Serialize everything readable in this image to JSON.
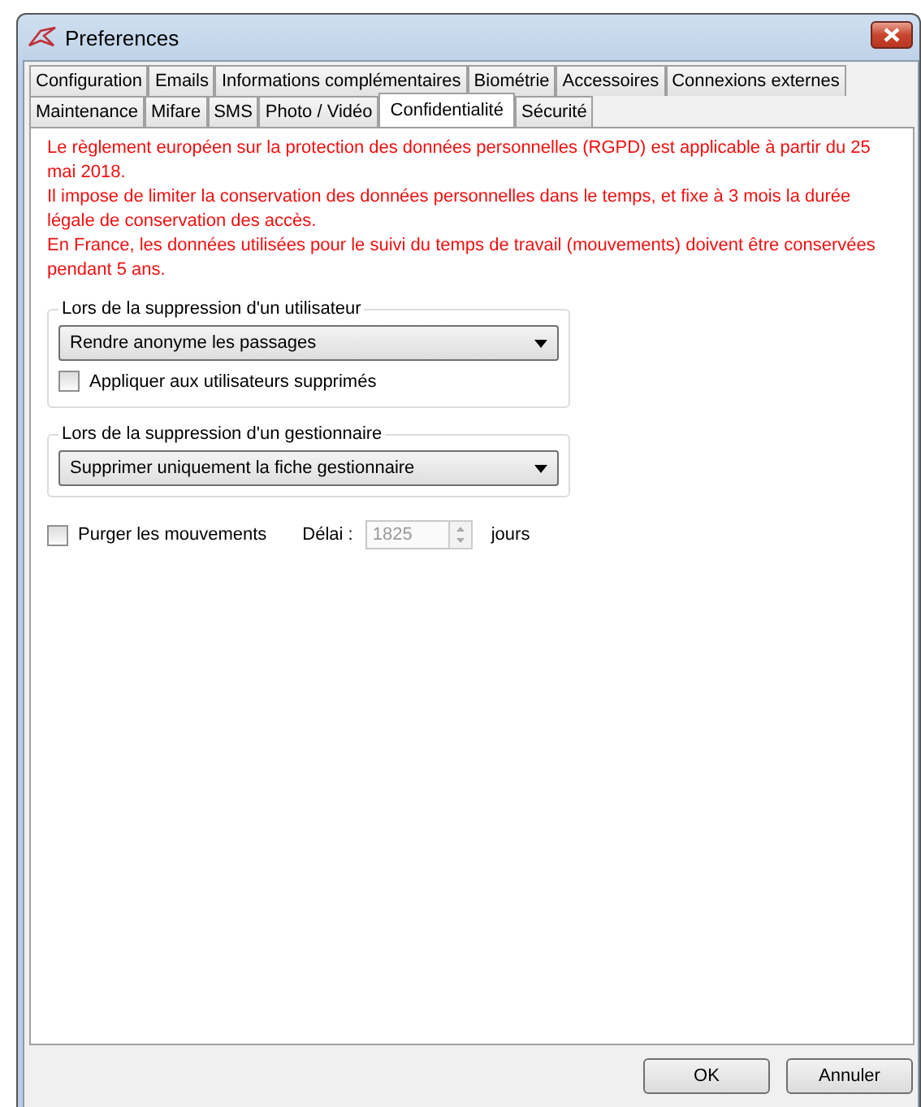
{
  "window": {
    "title": "Preferences"
  },
  "tab_rows": [
    [
      {
        "label": "Configuration",
        "selected": false
      },
      {
        "label": "Emails",
        "selected": false
      },
      {
        "label": "Informations complémentaires",
        "selected": false
      },
      {
        "label": "Biométrie",
        "selected": false
      },
      {
        "label": "Accessoires",
        "selected": false
      },
      {
        "label": "Connexions externes",
        "selected": false
      }
    ],
    [
      {
        "label": "Maintenance",
        "selected": false
      },
      {
        "label": "Mifare",
        "selected": false
      },
      {
        "label": "SMS",
        "selected": false
      },
      {
        "label": "Photo / Vidéo",
        "selected": false
      },
      {
        "label": "Confidentialité",
        "selected": true
      },
      {
        "label": "Sécurité",
        "selected": false
      }
    ]
  ],
  "notice": [
    "Le règlement européen sur la protection des données personnelles (RGPD) est applicable à partir du 25 mai 2018.",
    "Il impose de limiter la conservation des données personnelles dans le temps, et fixe à 3 mois la durée légale de conservation des accès.",
    "En France, les données utilisées pour le suivi du temps de travail (mouvements) doivent être conservées pendant 5 ans."
  ],
  "groups": [
    {
      "title": "Lors de la suppression d'un utilisateur",
      "dropdown": "Rendre anonyme les passages",
      "checkbox": {
        "label": "Appliquer aux utilisateurs supprimés",
        "checked": false
      }
    },
    {
      "title": "Lors de la suppression d'un gestionnaire",
      "dropdown": "Supprimer uniquement la fiche gestionnaire"
    }
  ],
  "purge": {
    "label": "Purger les mouvements",
    "checked": false,
    "delay_label": "Délai :",
    "delay_value": "1825",
    "disabled": true,
    "unit": "jours"
  },
  "buttons": [
    "OK",
    "Annuler"
  ]
}
